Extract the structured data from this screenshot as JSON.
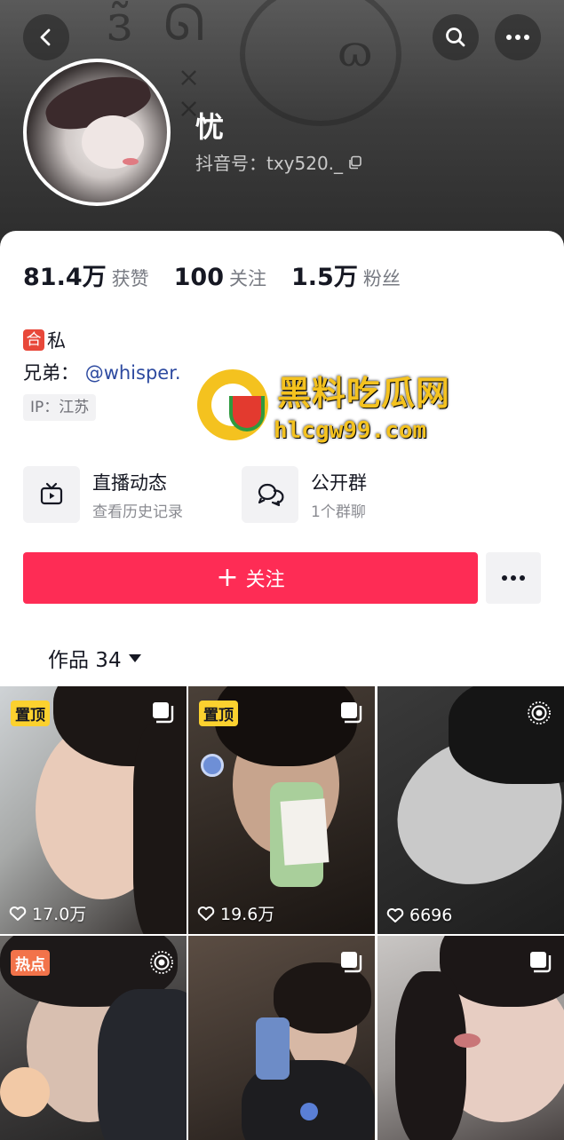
{
  "header": {
    "nickname": "忧",
    "douyin_id": "抖音号：txy520._",
    "icons": [
      "back-icon",
      "search-icon",
      "more-icon",
      "copy-icon"
    ]
  },
  "stats": [
    {
      "value": "81.4万",
      "label": "获赞"
    },
    {
      "value": "100",
      "label": "关注"
    },
    {
      "value": "1.5万",
      "label": "粉丝"
    }
  ],
  "bio": {
    "badge": "合",
    "line1": "私",
    "line2_prefix": "兄弟：",
    "mention": "@whisper.",
    "ip": "IP：江苏"
  },
  "watermark": {
    "title": "黑料吃瓜网",
    "url": "hlcgw99.com"
  },
  "cards": [
    {
      "title": "直播动态",
      "subtitle": "查看历史记录",
      "icon": "live-tv-icon"
    },
    {
      "title": "公开群",
      "subtitle": "1个群聊",
      "icon": "group-chat-icon"
    }
  ],
  "actions": {
    "follow_label": "关注"
  },
  "works_tab": {
    "label": "作品 34"
  },
  "tiles": [
    {
      "tag": "置顶",
      "likes": "17.0万",
      "corner": "multi-image-icon"
    },
    {
      "tag": "置顶",
      "likes": "19.6万",
      "corner": "multi-image-icon"
    },
    {
      "tag": "",
      "likes": "6696",
      "corner": "live-photo-icon"
    },
    {
      "tag": "热点",
      "likes": "",
      "corner": "live-photo-icon"
    },
    {
      "tag": "",
      "likes": "",
      "corner": "multi-image-icon"
    },
    {
      "tag": "",
      "likes": "",
      "corner": "multi-image-icon"
    }
  ],
  "colors": {
    "accent": "#fe2c55",
    "pin_tag": "#fbd12f",
    "hot_tag": "#f2734a",
    "mention": "#2d4aa0"
  }
}
